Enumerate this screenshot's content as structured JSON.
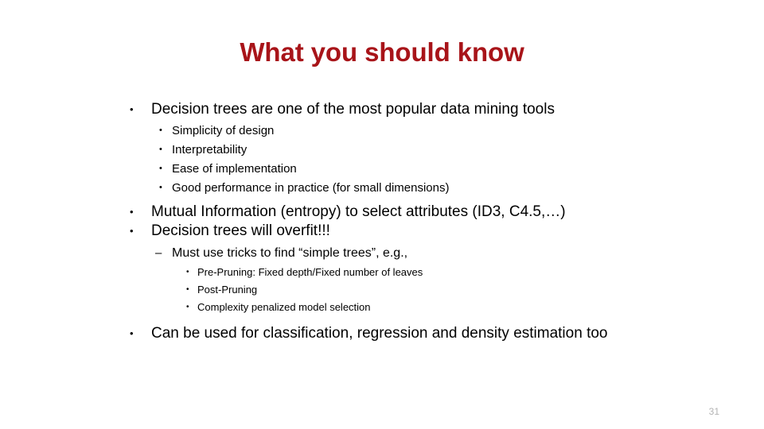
{
  "slide": {
    "title": "What you should know",
    "title_color": "#a81419",
    "background_color": "#ffffff",
    "page_number": "31",
    "page_number_color": "#b3b3b3",
    "bullet_glyph": "•",
    "dash_glyph": "–",
    "content": [
      {
        "level": 1,
        "marker": "•",
        "text": "Decision trees are one of the most popular data mining tools"
      },
      {
        "level": 2,
        "marker": "•",
        "text": "Simplicity of design"
      },
      {
        "level": 2,
        "marker": "•",
        "text": "Interpretability"
      },
      {
        "level": 2,
        "marker": "•",
        "text": "Ease of implementation"
      },
      {
        "level": 2,
        "marker": "•",
        "text": "Good performance in practice (for small dimensions)"
      },
      {
        "level": 1,
        "marker": "•",
        "text": "Mutual Information (entropy) to select attributes (ID3, C4.5,…)"
      },
      {
        "level": 1,
        "marker": "•",
        "text": "Decision trees will overfit!!!"
      },
      {
        "level": 3,
        "marker": "–",
        "text": "Must use tricks to find “simple trees”, e.g.,"
      },
      {
        "level": 4,
        "marker": "•",
        "text": "Pre-Pruning: Fixed depth/Fixed number of leaves"
      },
      {
        "level": 4,
        "marker": "•",
        "text": "Post-Pruning"
      },
      {
        "level": 4,
        "marker": "•",
        "text": "Complexity penalized model selection"
      },
      {
        "level": 1,
        "marker": "•",
        "text": "Can be used for classification, regression and density estimation too"
      }
    ]
  }
}
